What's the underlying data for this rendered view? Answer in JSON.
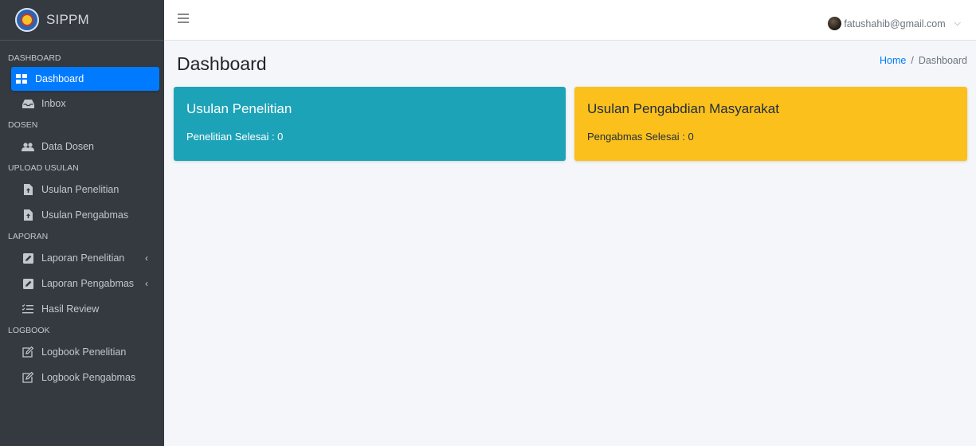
{
  "brand": {
    "name": "SIPPM",
    "logo_icon": "university-logo-icon"
  },
  "topbar": {
    "user_email": "fatushahib@gmail.com"
  },
  "sidebar": {
    "sections": [
      {
        "header": "DASHBOARD",
        "items": [
          {
            "label": "Dashboard",
            "icon": "dashboard-icon",
            "active": true
          },
          {
            "label": "Inbox",
            "icon": "inbox-icon"
          }
        ]
      },
      {
        "header": "DOSEN",
        "items": [
          {
            "label": "Data Dosen",
            "icon": "users-icon"
          }
        ]
      },
      {
        "header": "UPLOAD USULAN",
        "items": [
          {
            "label": "Usulan Penelitian",
            "icon": "file-upload-icon"
          },
          {
            "label": "Usulan Pengabmas",
            "icon": "file-upload-icon"
          }
        ]
      },
      {
        "header": "LAPORAN",
        "items": [
          {
            "label": "Laporan Penelitian",
            "icon": "edit-square-icon",
            "has_submenu": true
          },
          {
            "label": "Laporan Pengabmas",
            "icon": "edit-square-icon",
            "has_submenu": true
          },
          {
            "label": "Hasil Review",
            "icon": "tasks-list-icon"
          }
        ]
      },
      {
        "header": "LOGBOOK",
        "items": [
          {
            "label": "Logbook Penelitian",
            "icon": "edit-outline-icon"
          },
          {
            "label": "Logbook Pengabmas",
            "icon": "edit-outline-icon"
          }
        ]
      }
    ]
  },
  "content": {
    "title": "Dashboard",
    "breadcrumb": {
      "home": "Home",
      "separator": "/",
      "current": "Dashboard"
    },
    "cards": [
      {
        "title": "Usulan Penelitian",
        "text": "Penelitian Selesai : 0",
        "color": "#1da3b8"
      },
      {
        "title": "Usulan Pengabdian Masyarakat",
        "text": "Pengabmas Selesai : 0",
        "color": "#fcc01c"
      }
    ]
  },
  "colors": {
    "sidebar_bg": "#343a40",
    "accent": "#007bff",
    "content_bg": "#f4f6f9"
  }
}
